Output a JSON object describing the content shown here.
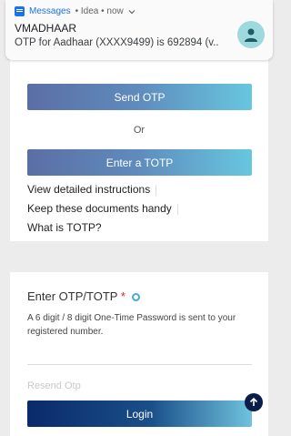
{
  "notification": {
    "app": "Messages",
    "meta": "• Idea • now",
    "sender": "VMADHAAR",
    "text": "OTP for Aadhaar (XXXX9499) is 692894 (v.."
  },
  "card1": {
    "send_otp": "Send OTP",
    "or": "Or",
    "enter_totp": "Enter a TOTP",
    "links": [
      "View detailed instructions",
      "Keep these documents handy",
      "What is TOTP?"
    ]
  },
  "card2": {
    "label": "Enter OTP/TOTP",
    "required_mark": "*",
    "helper": "A 6 digit / 8 digit One-Time Password is sent to your registered number.",
    "resend": "Resend Otp",
    "login": "Login"
  }
}
